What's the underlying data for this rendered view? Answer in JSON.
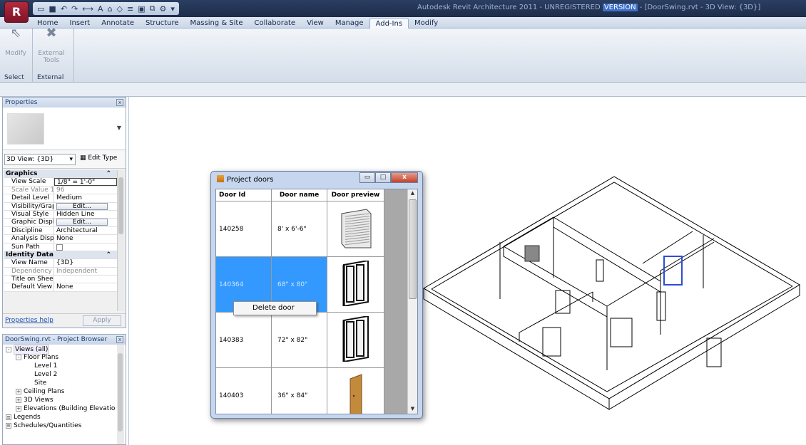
{
  "app": {
    "title_prefix": "Autodesk Revit Architecture 2011 - UNREGISTERED ",
    "title_highlight": "VERSION",
    "title_suffix": " - [DoorSwing.rvt - 3D View: {3D}]",
    "app_button": "R"
  },
  "ribbon": {
    "tabs": [
      "Home",
      "Insert",
      "Annotate",
      "Structure",
      "Massing & Site",
      "Collaborate",
      "View",
      "Manage",
      "Add-Ins",
      "Modify"
    ],
    "active_tab": "Add-Ins",
    "modify_label": "Modify",
    "external_tools_label_1": "External",
    "external_tools_label_2": "Tools",
    "group_select": "Select",
    "group_external": "External"
  },
  "properties": {
    "title": "Properties",
    "type_selector": "3D View: {3D}",
    "edit_type": "Edit Type",
    "rows": [
      {
        "k": "Graphics",
        "v": "",
        "section": true
      },
      {
        "k": "View Scale",
        "v": "1/8\" = 1'-0\""
      },
      {
        "k": "Scale Value 1:",
        "v": "96",
        "dim": true
      },
      {
        "k": "Detail Level",
        "v": "Medium"
      },
      {
        "k": "Visibility/Grap...",
        "v": "Edit...",
        "button": true
      },
      {
        "k": "Visual Style",
        "v": "Hidden Line"
      },
      {
        "k": "Graphic Displ...",
        "v": "Edit...",
        "button": true
      },
      {
        "k": "Discipline",
        "v": "Architectural"
      },
      {
        "k": "Analysis Displ...",
        "v": "None"
      },
      {
        "k": "Sun Path",
        "v": "",
        "checkbox": true
      },
      {
        "k": "Identity Data",
        "v": "",
        "section": true
      },
      {
        "k": "View Name",
        "v": "{3D}"
      },
      {
        "k": "Dependency",
        "v": "Independent",
        "dim": true
      },
      {
        "k": "Title on Sheet",
        "v": ""
      },
      {
        "k": "Default View ...",
        "v": "None"
      }
    ],
    "help_link": "Properties help",
    "apply": "Apply"
  },
  "browser": {
    "title": "DoorSwing.rvt - Project Browser",
    "nodes": [
      {
        "label": "Views (all)",
        "depth": 0,
        "pm": "-"
      },
      {
        "label": "Floor Plans",
        "depth": 1,
        "pm": "-"
      },
      {
        "label": "Level 1",
        "depth": 2,
        "pm": ""
      },
      {
        "label": "Level 2",
        "depth": 2,
        "pm": ""
      },
      {
        "label": "Site",
        "depth": 2,
        "pm": ""
      },
      {
        "label": "Ceiling Plans",
        "depth": 1,
        "pm": "+"
      },
      {
        "label": "3D Views",
        "depth": 1,
        "pm": "+"
      },
      {
        "label": "Elevations (Building Elevatio",
        "depth": 1,
        "pm": "+"
      },
      {
        "label": "Legends",
        "depth": 0,
        "pm": ""
      },
      {
        "label": "Schedules/Quantities",
        "depth": 0,
        "pm": ""
      }
    ]
  },
  "dialog": {
    "title": "Project doors",
    "headers": [
      "Door Id",
      "Door name",
      "Door preview"
    ],
    "rows": [
      {
        "id": "140258",
        "name": "8' x 6'-6\"",
        "preview": "overhead-door"
      },
      {
        "id": "140364",
        "name": "68\" x 80\"",
        "preview": "double-door"
      },
      {
        "id": "140383",
        "name": "72\" x 82\"",
        "preview": "double-door"
      },
      {
        "id": "140403",
        "name": "36\" x 84\"",
        "preview": "single-door"
      }
    ],
    "selected_row": 1,
    "context_menu_item": "Delete door"
  }
}
